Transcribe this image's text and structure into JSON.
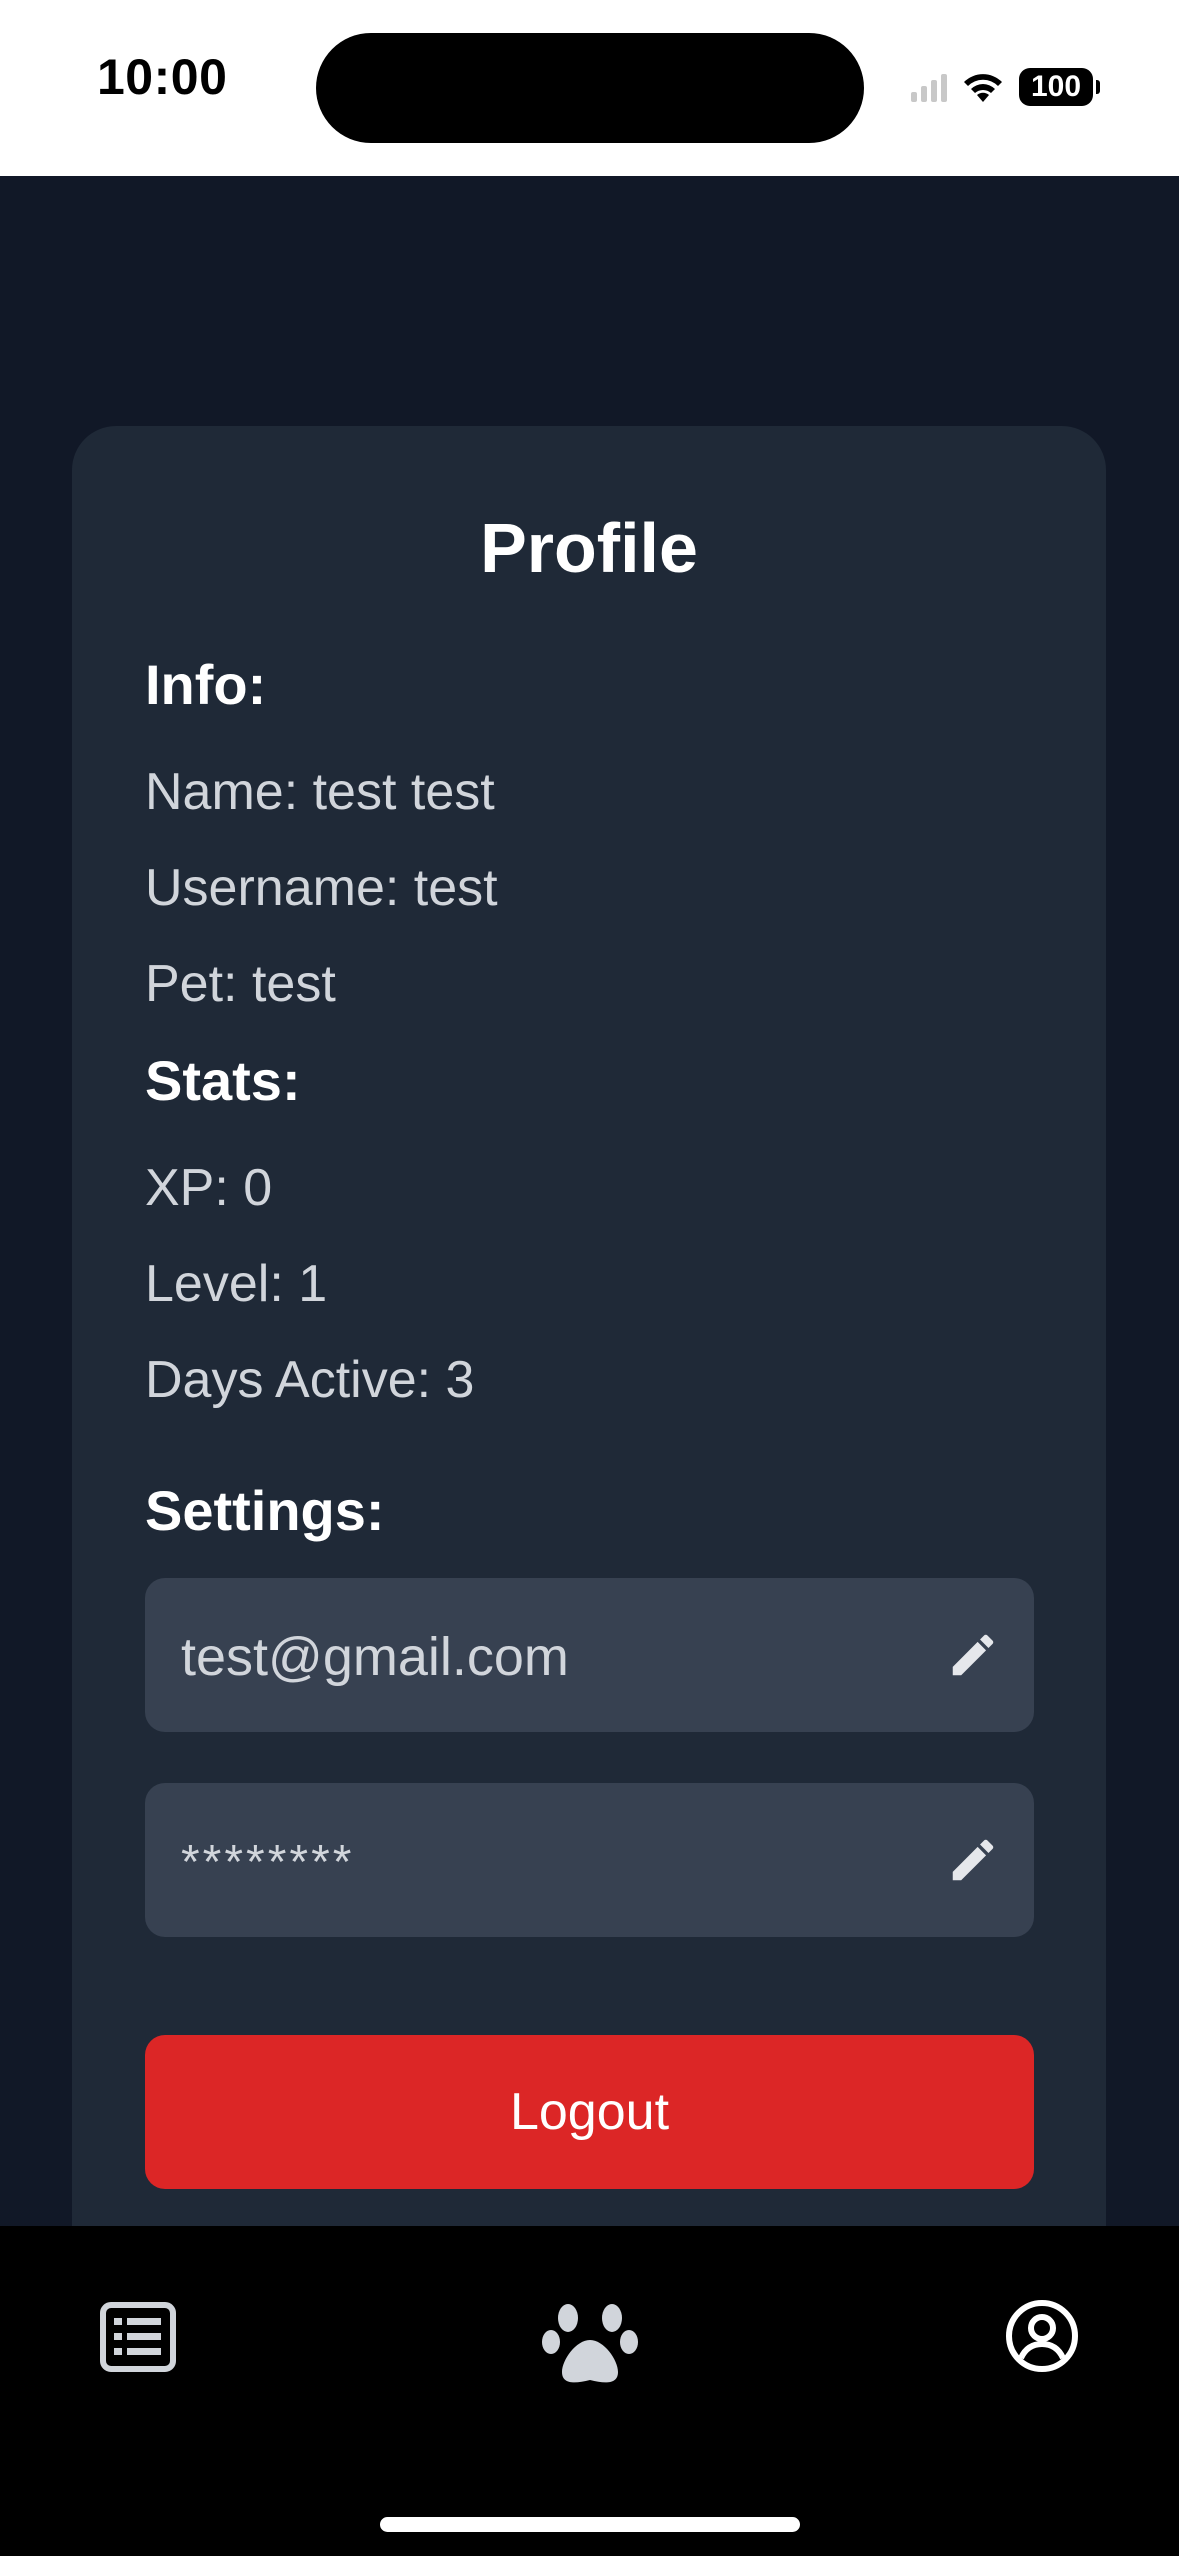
{
  "status_bar": {
    "time": "10:00",
    "battery": "100"
  },
  "profile": {
    "title": "Profile",
    "info_heading": "Info:",
    "name_line": "Name: test test",
    "username_line": "Username: test",
    "pet_line": "Pet: test",
    "stats_heading": "Stats:",
    "xp_line": "XP: 0",
    "level_line": "Level: 1",
    "days_active_line": "Days Active: 3",
    "settings_heading": "Settings:",
    "email_value": "test@gmail.com",
    "password_value": "********",
    "logout_label": "Logout"
  },
  "tab_bar": {
    "tabs": [
      {
        "icon": "list-icon"
      },
      {
        "icon": "paw-icon"
      },
      {
        "icon": "user-circle-icon"
      }
    ]
  },
  "colors": {
    "background": "#111827",
    "card": "#1f2937",
    "field": "#374151",
    "danger": "#dc2626"
  }
}
